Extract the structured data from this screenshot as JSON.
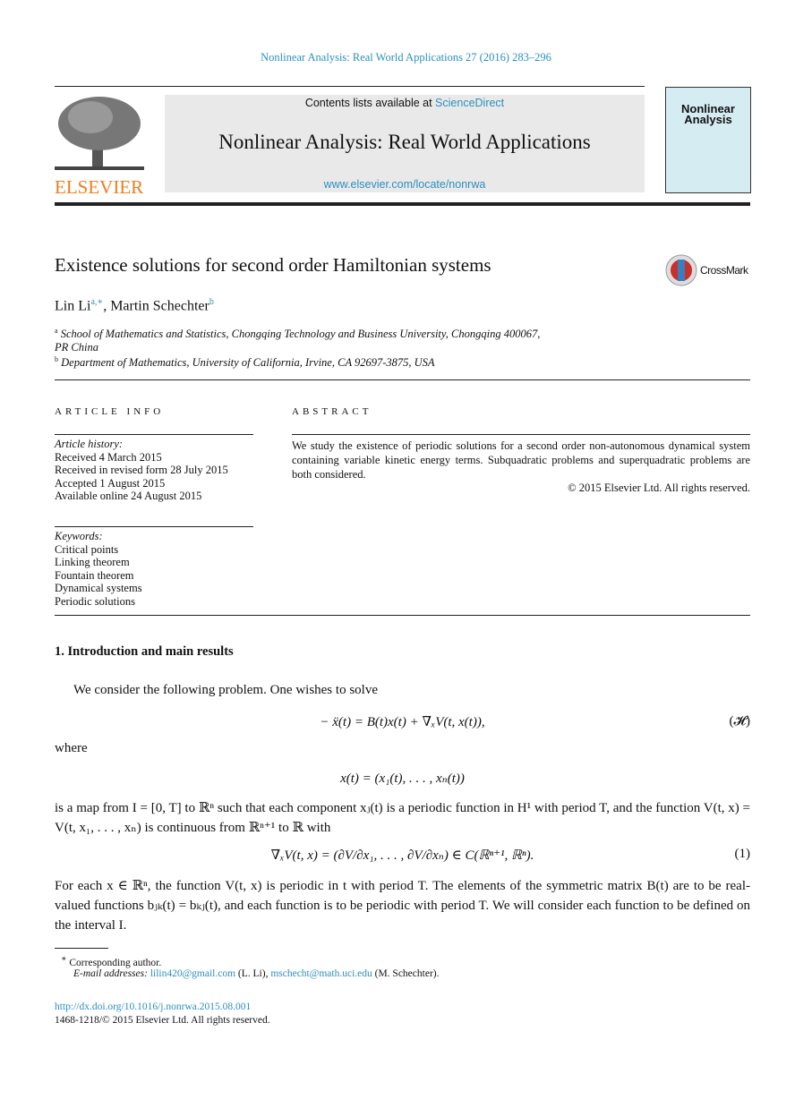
{
  "header": {
    "citation": "Nonlinear Analysis: Real World Applications 27 (2016) 283–296",
    "contents_prefix": "Contents lists available at ",
    "sciencedirect": "ScienceDirect",
    "journal": "Nonlinear Analysis: Real World Applications",
    "url": "www.elsevier.com/locate/nonrwa",
    "publisher": "ELSEVIER",
    "cover_title": "Nonlinear Analysis"
  },
  "colors": {
    "link": "#2a8fbf",
    "elsevier": "#f07c1e",
    "banner_bg": "#e9e9e9",
    "cover_bg": "#d6ecf3"
  },
  "article": {
    "title": "Existence solutions for second order Hamiltonian systems",
    "crossmark": "CrossMark",
    "author1": "Lin Li",
    "author1_sup": "a,∗",
    "author2": ", Martin Schechter",
    "author2_sup": "b",
    "aff_a_sup": "a",
    "aff_a": "School of Mathematics and Statistics, Chongqing Technology and Business University, Chongqing 400067, PR China",
    "aff_b_sup": "b",
    "aff_b": "Department of Mathematics, University of California, Irvine, CA 92697-3875, USA"
  },
  "info": {
    "heading": "ARTICLE INFO",
    "history_label": "Article history:",
    "history": [
      "Received 4 March 2015",
      "Received in revised form 28 July 2015",
      "Accepted 1 August 2015",
      "Available online 24 August 2015"
    ],
    "keywords_label": "Keywords:",
    "keywords": [
      "Critical points",
      "Linking theorem",
      "Fountain theorem",
      "Dynamical systems",
      "Periodic solutions"
    ]
  },
  "abstract": {
    "heading": "ABSTRACT",
    "text": "We study the existence of periodic solutions for a second order non-autonomous dynamical system containing variable kinetic energy terms. Subquadratic problems and superquadratic problems are both considered.",
    "copyright": "© 2015 Elsevier Ltd. All rights reserved."
  },
  "section": {
    "title": "1.  Introduction and main results",
    "p1": "We consider the following problem. One wishes to solve",
    "eq_h": "− ẍ(t) = B(t)x(t) + ∇ₓV(t, x(t)),",
    "eq_h_label": "(𝓗)",
    "p2": "where",
    "eq_x": "x(t) = (x₁(t), . . . , xₙ(t))",
    "p3": "is a map from I = [0, T] to ℝⁿ such that each component xⱼ(t) is a periodic function in H¹ with period T, and the function V(t, x) = V(t, x₁, . . . , xₙ) is continuous from ℝⁿ⁺¹ to ℝ with",
    "eq_1": "∇ₓV(t, x) = (∂V/∂x₁, . . . , ∂V/∂xₙ) ∈ C(ℝⁿ⁺¹, ℝⁿ).",
    "eq_1_label": "(1)",
    "p4": "For each x ∈ ℝⁿ, the function V(t, x) is periodic in t with period T. The elements of the symmetric matrix B(t) are to be real-valued functions bⱼₖ(t) = bₖⱼ(t), and each function is to be periodic with period T. We will consider each function to be defined on the interval I."
  },
  "footnote": {
    "star": "∗",
    "corresponding": "Corresponding author.",
    "email_label": "E-mail addresses:",
    "email1": "lilin420@gmail.com",
    "name1": " (L. Li), ",
    "email2": "mschecht@math.uci.edu",
    "name2": " (M. Schechter)."
  },
  "footer": {
    "doi": "http://dx.doi.org/10.1016/j.nonrwa.2015.08.001",
    "issn": "1468-1218/© 2015 Elsevier Ltd. All rights reserved."
  }
}
